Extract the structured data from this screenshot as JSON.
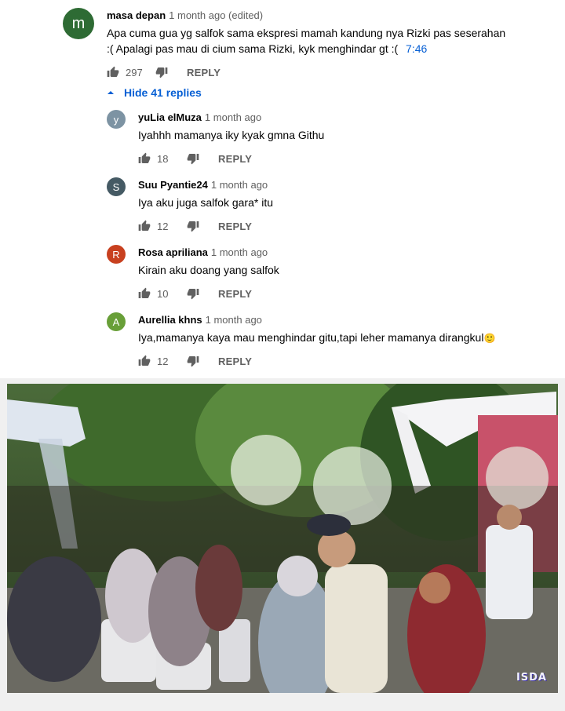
{
  "main_comment": {
    "avatar_letter": "m",
    "avatar_color": "#2e6b34",
    "author": "masa depan",
    "time": "1 month ago (edited)",
    "text_line1": "Apa cuma gua yg salfok sama ekspresi mamah kandung nya Rizki pas seserahan",
    "text_line2": ":(  Apalagi pas mau di cium sama Rizki, kyk menghindar gt :(",
    "timestamp_link": "7:46",
    "likes": "297",
    "reply_label": "REPLY"
  },
  "replies_toggle": {
    "label": "Hide 41 replies",
    "icon": "chevron-up-icon"
  },
  "replies": [
    {
      "avatar_letter": "y",
      "avatar_color": "#7d93a3",
      "author": "yuLia elMuza",
      "time": "1 month ago",
      "text": "Iyahhh mamanya iky kyak gmna Githu",
      "likes": "18",
      "reply_label": "REPLY"
    },
    {
      "avatar_letter": "S",
      "avatar_color": "#455a64",
      "author": "Suu Pyantie24",
      "time": "1 month ago",
      "text": "Iya aku juga salfok gara* itu",
      "likes": "12",
      "reply_label": "REPLY"
    },
    {
      "avatar_letter": "R",
      "avatar_color": "#c8401f",
      "author": "Rosa apriliana",
      "time": "1 month ago",
      "text": "Kirain aku doang yang salfok",
      "likes": "10",
      "reply_label": "REPLY"
    },
    {
      "avatar_letter": "A",
      "avatar_color": "#689f38",
      "author": "Aurellia khns",
      "time": "1 month ago",
      "text": "Iya,mamanya kaya mau menghindar gitu,tapi leher mamanya dirangkul",
      "emoji": "🙂",
      "likes": "12",
      "reply_label": "REPLY"
    }
  ],
  "video": {
    "watermark": "ISDA"
  },
  "colors": {
    "link": "#065fd4",
    "secondary_text": "#606060",
    "primary_text": "#030303"
  }
}
